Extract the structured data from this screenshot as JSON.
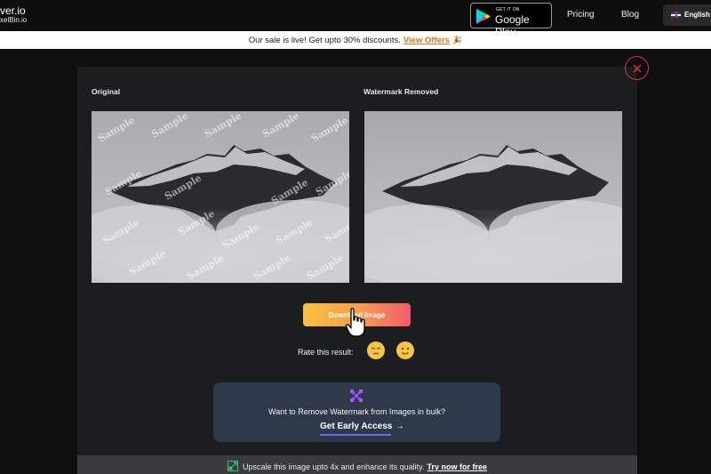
{
  "header": {
    "brand_main": "ver.io",
    "brand_sub": "xelBin.io",
    "google_play_small": "GET IT ON",
    "google_play_big": "Google Play",
    "nav": {
      "pricing": "Pricing",
      "blog": "Blog"
    },
    "language": "English"
  },
  "banner": {
    "text": "Our sale is live! Get upto 30% discounts.",
    "link": "View Offers",
    "emoji": "🎉"
  },
  "result": {
    "original_label": "Original",
    "removed_label": "Watermark Removed",
    "watermark_text": "Sample",
    "download_label": "Download Image",
    "rate_label": "Rate this result:"
  },
  "bulk": {
    "text": "Want to Remove Watermark from Images in bulk?",
    "link": "Get Early Access",
    "arrow": "→"
  },
  "upscale": {
    "text": "Upscale this image upto 4x and enhance its quality.",
    "link": "Try now for free"
  },
  "icons": {
    "close": "close-icon",
    "google_play": "google-play-icon",
    "flag": "uk-flag-icon",
    "bulk": "pixel-grid-icon",
    "upscale": "upscale-icon",
    "cursor": "hand-pointer-icon"
  },
  "colors": {
    "accent_orange": "#e0741f",
    "close_red": "#e0364a",
    "button_gradient_start": "#f7c33c",
    "button_gradient_end": "#f35a6e",
    "underline_purple": "#7b5cff"
  }
}
